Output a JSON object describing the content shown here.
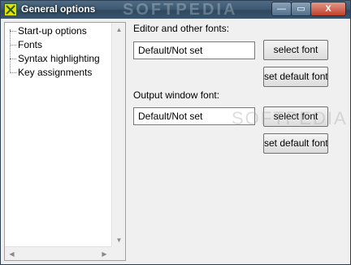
{
  "window": {
    "title": "General options",
    "watermark": "SOFTPEDIA",
    "controls": {
      "minimize": "—",
      "maximize": "▭",
      "close": "X"
    }
  },
  "tree": {
    "items": [
      {
        "label": "Start-up options"
      },
      {
        "label": "Fonts"
      },
      {
        "label": "Syntax highlighting"
      },
      {
        "label": "Key assignments"
      }
    ]
  },
  "fonts": {
    "editor_label": "Editor and other fonts:",
    "editor_value": "Default/Not set",
    "output_label": "Output window font:",
    "output_value": "Default/Not set",
    "select_font": "select font",
    "set_default_font": "set default font"
  },
  "colors": {
    "titlebar": "#3e5a73",
    "face": "#f0f0f0",
    "close": "#c0412a"
  }
}
